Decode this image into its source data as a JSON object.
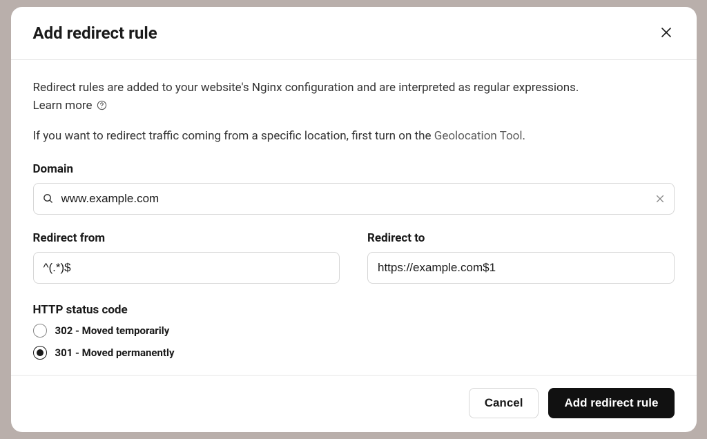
{
  "modal": {
    "title": "Add redirect rule",
    "description": "Redirect rules are added to your website's Nginx configuration and are interpreted as regular expressions.",
    "learn_more": "Learn more",
    "geo_note_prefix": "If you want to redirect traffic coming from a specific location, first turn on the ",
    "geo_link": "Geolocation Tool",
    "geo_note_suffix": "."
  },
  "domain": {
    "label": "Domain",
    "value": "www.example.com"
  },
  "redirect_from": {
    "label": "Redirect from",
    "value": "^(.*)$"
  },
  "redirect_to": {
    "label": "Redirect to",
    "value": "https://example.com$1"
  },
  "status_code": {
    "label": "HTTP status code",
    "options": {
      "opt302": "302 - Moved temporarily",
      "opt301": "301 - Moved permanently"
    },
    "selected": "opt301"
  },
  "footer": {
    "cancel": "Cancel",
    "submit": "Add redirect rule"
  }
}
